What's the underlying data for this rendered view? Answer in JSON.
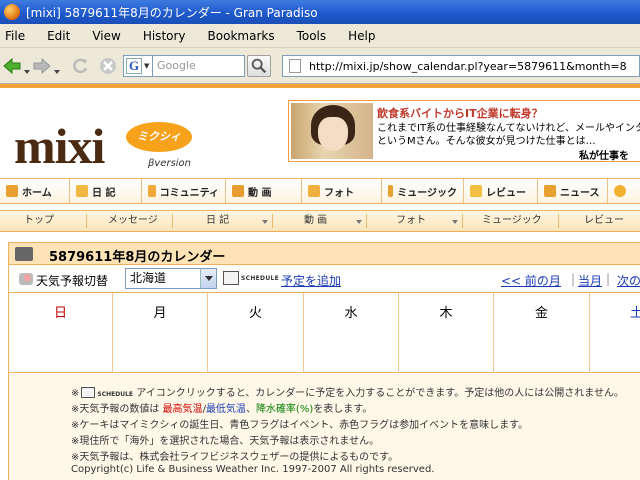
{
  "window": {
    "title": "[mixi] 5879611年8月のカレンダー - Gran Paradiso"
  },
  "menu": [
    "File",
    "Edit",
    "View",
    "History",
    "Bookmarks",
    "Tools",
    "Help"
  ],
  "toolbar": {
    "search_engine_letter": "G",
    "search_placeholder": "Google",
    "url": "http://mixi.jp/show_calendar.pl?year=5879611&month=8"
  },
  "logo": {
    "name": "mixi",
    "bubble": "ミクシィ",
    "beta": "βversion"
  },
  "ad": {
    "headline": "飲食系バイトからIT企業に転身？",
    "line1": "これまでIT系の仕事経験なんてないけれど、メールやインター",
    "line2": "というMさん。そんな彼女が見つけた仕事とは…",
    "footer": "私が仕事を"
  },
  "main_nav": [
    "ホーム",
    "日 記",
    "コミュニティ",
    "動 画",
    "フォト",
    "ミュージック",
    "レビュー",
    "ニュース"
  ],
  "sub_nav": [
    "トップ",
    "メッセージ",
    "日 記",
    "動 画",
    "フォト",
    "ミュージック",
    "レビュー"
  ],
  "calendar": {
    "title": "5879611年8月のカレンダー",
    "weather_label": "天気予報切替",
    "region": "北海道",
    "schedule_word": "SCHEDULE",
    "add_link": "予定を追加",
    "prev_month": "<< 前の月",
    "current_month": "当月",
    "next_month": "次の",
    "separator": "|",
    "weekdays": [
      "日",
      "月",
      "火",
      "水",
      "木",
      "金",
      "土"
    ]
  },
  "notes": {
    "n1_pre": "※",
    "n1_post": "アイコンクリックすると、カレンダーに予定を入力することができます。予定は他の人には公開されません。",
    "n2_pre": "※天気予報の数値は ",
    "n2_high": "最高気温",
    "n2_slash": "/",
    "n2_low": "最低気温",
    "n2_comma": "、",
    "n2_rain": "降水確率(%)",
    "n2_post": "を表します。",
    "n3": "※ケーキはマイミクシィの誕生日、青色フラグはイベント、赤色フラグは参加イベントを意味します。",
    "n4": "※現住所で「海外」を選択された場合、天気予報は表示されません。",
    "n5": "※天気予報は、株式会社ライフビジネスウェザーの提供によるものです。",
    "copyright": "Copyright(c) Life & Business Weather Inc. 1997-2007 All rights reserved."
  },
  "colors": {
    "accent": "#f4a23a",
    "link": "#1a3bb6",
    "sunday": "#c00000",
    "titlebar": "#1d57c9"
  }
}
